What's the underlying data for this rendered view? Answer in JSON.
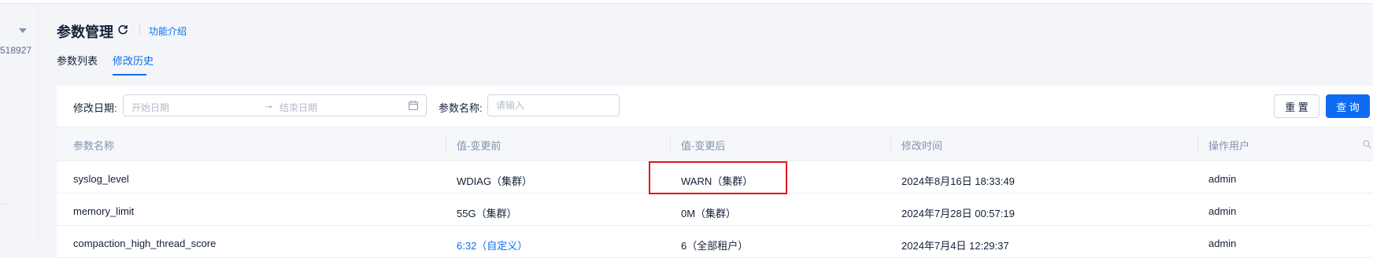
{
  "sidebar": {
    "id_text": "518927"
  },
  "header": {
    "title": "参数管理",
    "intro_link": "功能介绍"
  },
  "tabs": [
    {
      "label": "参数列表",
      "active": false
    },
    {
      "label": "修改历史",
      "active": true
    }
  ],
  "filters": {
    "date_label": "修改日期:",
    "date_start_placeholder": "开始日期",
    "date_arrow": "→",
    "date_end_placeholder": "结束日期",
    "name_label": "参数名称:",
    "name_placeholder": "请输入",
    "name_value": "",
    "reset_label": "重 置",
    "query_label": "查 询"
  },
  "table": {
    "headers": [
      "参数名称",
      "值-变更前",
      "值-变更后",
      "修改时间",
      "操作用户"
    ],
    "rows": [
      [
        "syslog_level",
        "WDIAG（集群）",
        "WARN（集群）",
        "2024年8月16日 18:33:49",
        "admin"
      ],
      [
        "memory_limit",
        "55G（集群）",
        "0M（集群）",
        "2024年7月28日 00:57:19",
        "admin"
      ],
      [
        "compaction_high_thread_score",
        "6:32（自定义）",
        "6（全部租户）",
        "2024年7月4日 12:29:37",
        "admin"
      ]
    ]
  },
  "colors": {
    "accent": "#0d6cf2",
    "highlight": "#e5171b"
  },
  "icons": {
    "refresh": "refresh-icon",
    "calendar": "calendar-icon",
    "search": "search-icon",
    "dropdown": "caret-down-icon"
  }
}
